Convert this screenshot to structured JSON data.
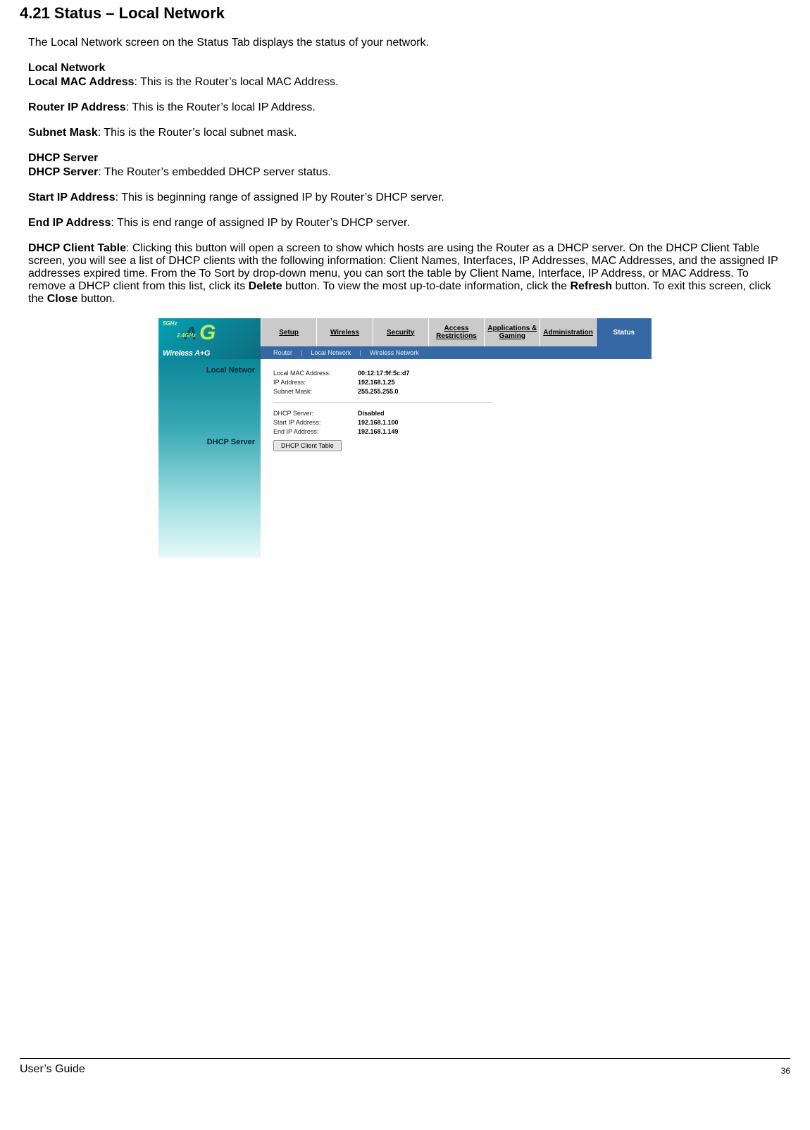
{
  "section": {
    "title": "4.21 Status – Local Network",
    "intro": "The Local Network screen on the Status Tab displays the status of your network."
  },
  "localNetwork": {
    "heading": "Local Network",
    "mac": {
      "label": "Local MAC Address",
      "text": ": This is the Router’s local MAC Address."
    },
    "ip": {
      "label": "Router IP Address",
      "text": ": This is the Router’s local IP Address."
    },
    "mask": {
      "label": "Subnet Mask",
      "text": ": This is the Router’s local subnet mask."
    }
  },
  "dhcp": {
    "heading": "DHCP Server",
    "server": {
      "label": "DHCP Server",
      "text": ": The Router’s embedded DHCP server status."
    },
    "start": {
      "label": "Start IP Address",
      "text": ": This is beginning range of assigned IP by Router’s DHCP server."
    },
    "end": {
      "label": "End IP Address",
      "text": ": This is end range of assigned IP by Router’s DHCP server."
    },
    "table": {
      "label": "DHCP Client Table",
      "pre": ": Clicking this button will open a screen to show which hosts are using the Router as a DHCP server. On the DHCP Client Table screen, you will see a list of DHCP clients  with the following information: Client Names, Interfaces, IP Addresses, MAC Addresses, and the assigned IP addresses expired time. From the To Sort by drop-down menu, you can sort the table by Client Name, Interface, IP Address, or MAC Address. To remove a DHCP client from this list, click its ",
      "delete": "Delete",
      "mid": " button. To view the most up-to-date information, click the ",
      "refresh": "Refresh",
      "post": " button. To exit this screen, click the ",
      "close": "Close",
      "tail": " button."
    }
  },
  "screenshot": {
    "logo": {
      "ghz": "5GHz",
      "big": "A",
      "bigG": "G",
      "sub24": "2.4GHz",
      "brand": "Wireless A+G"
    },
    "tabs": [
      "Setup",
      "Wireless",
      "Security",
      "Access Restrictions",
      "Applications & Gaming",
      "Administration",
      "Status"
    ],
    "subtabs": [
      "Router",
      "Local Network",
      "Wireless Network"
    ],
    "side": {
      "localNetwork": "Local Networ",
      "dhcp": "DHCP Server"
    },
    "rows": {
      "mac": {
        "k": "Local MAC Address:",
        "v": "00:12:17:9f:5c:d7"
      },
      "ip": {
        "k": "IP Address:",
        "v": "192.168.1.25"
      },
      "mask": {
        "k": "Subnet Mask:",
        "v": "255.255.255.0"
      },
      "dhcp": {
        "k": "DHCP Server:",
        "v": "Disabled"
      },
      "start": {
        "k": "Start IP Address:",
        "v": "192.168.1.100"
      },
      "end": {
        "k": "End IP Address:",
        "v": "192.168.1.149"
      }
    },
    "button": "DHCP Client Table"
  },
  "footer": {
    "left": "User’s Guide",
    "page": "36"
  }
}
